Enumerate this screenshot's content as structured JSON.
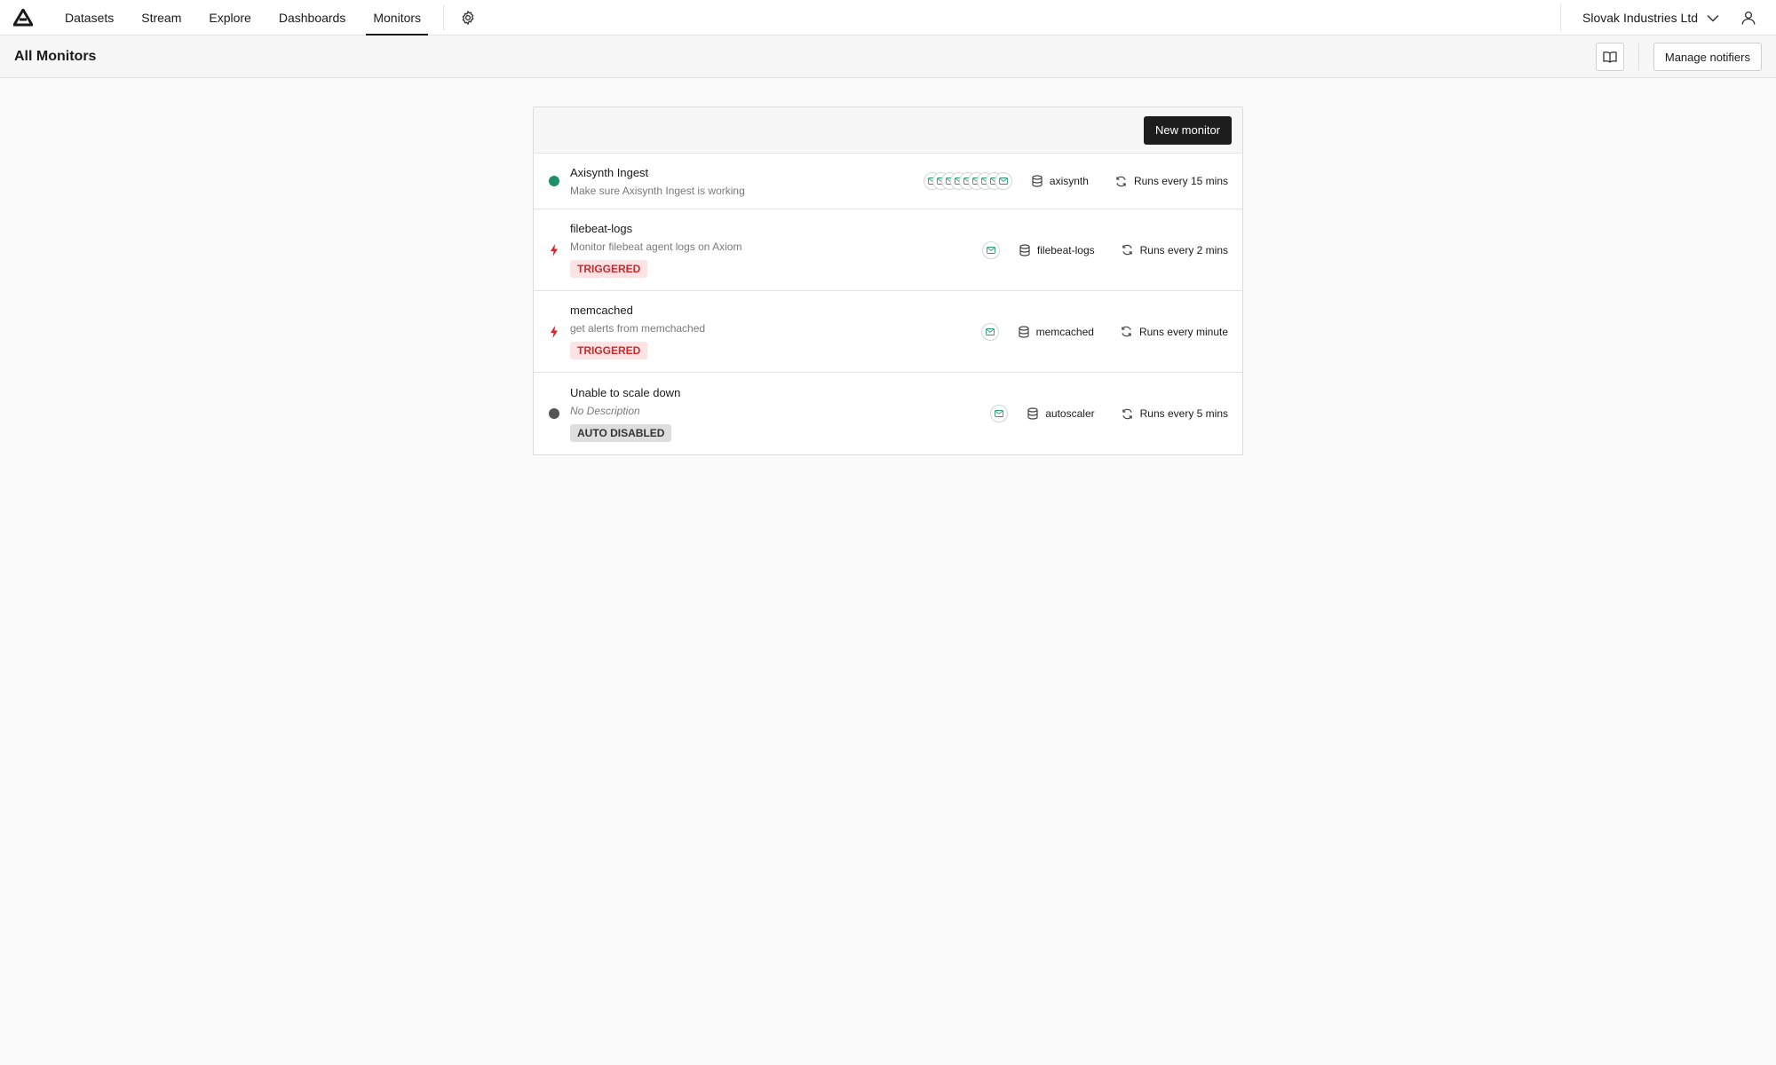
{
  "nav": {
    "items": [
      {
        "label": "Datasets",
        "active": false
      },
      {
        "label": "Stream",
        "active": false
      },
      {
        "label": "Explore",
        "active": false
      },
      {
        "label": "Dashboards",
        "active": false
      },
      {
        "label": "Monitors",
        "active": true
      }
    ],
    "settings_icon": "gear-icon",
    "org_name": "Slovak Industries Ltd",
    "user_icon": "user-icon"
  },
  "header": {
    "title": "All Monitors",
    "docs_icon": "book-icon",
    "manage_label": "Manage notifiers"
  },
  "monitors": {
    "new_label": "New monitor",
    "colors": {
      "ok": "#1f8f6a",
      "triggered": "#d6262b",
      "disabled": "#555555"
    },
    "rows": [
      {
        "name": "Axisynth Ingest",
        "description": "Make sure Axisynth Ingest is working",
        "status": "ok",
        "badge": "",
        "notifier_count": 9,
        "dataset": "axisynth",
        "schedule": "Runs every 15 mins"
      },
      {
        "name": "filebeat-logs",
        "description": "Monitor filebeat agent logs on Axiom",
        "status": "triggered",
        "badge": "TRIGGERED",
        "notifier_count": 1,
        "dataset": "filebeat-logs",
        "schedule": "Runs every 2 mins"
      },
      {
        "name": "memcached",
        "description": "get alerts from memchached",
        "status": "triggered",
        "badge": "TRIGGERED",
        "notifier_count": 1,
        "dataset": "memcached",
        "schedule": "Runs every minute"
      },
      {
        "name": "Unable to scale down",
        "description": "No Description",
        "status": "disabled",
        "badge": "AUTO DISABLED",
        "notifier_count": 1,
        "dataset": "autoscaler",
        "schedule": "Runs every 5 mins"
      }
    ]
  }
}
